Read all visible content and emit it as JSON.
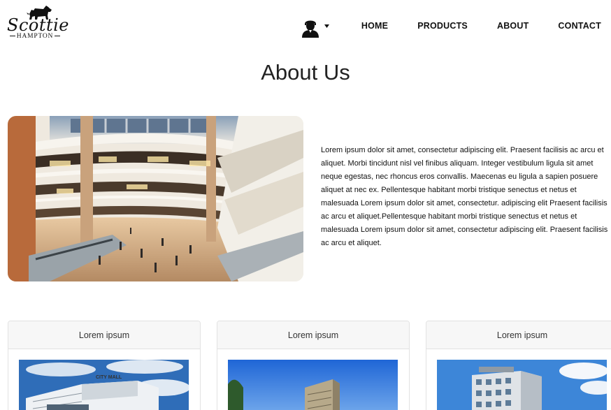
{
  "brand": {
    "logo_script": "Scottie",
    "logo_sub": "HAMPTON",
    "logo_icon": "scottie-dog-icon"
  },
  "nav": {
    "user_icon": "user-icon",
    "user_menu_caret": "caret-down-icon",
    "links": [
      {
        "label": "HOME"
      },
      {
        "label": "PRODUCTS"
      },
      {
        "label": "ABOUT"
      },
      {
        "label": "CONTACT"
      }
    ]
  },
  "page": {
    "title": "About Us",
    "image_subject": "shopping-mall-atrium-photo",
    "body": "Lorem ipsum dolor sit amet, consectetur adipiscing elit. Praesent facilisis ac arcu et aliquet. Morbi tincidunt nisl vel finibus aliquam. Integer vestibulum ligula sit amet neque egestas, nec rhoncus eros convallis. Maecenas eu ligula a sapien posuere aliquet at nec ex. Pellentesque habitant morbi tristique senectus et netus et malesuada Lorem ipsum dolor sit amet, consectetur. adipiscing elit Praesent facilisis ac arcu et aliquet.Pellentesque habitant morbi tristique senectus et netus et malesuada Lorem ipsum dolor sit amet, consectetur adipiscing elit. Praesent facilisis ac arcu et aliquet."
  },
  "cards": [
    {
      "header": "Lorem ipsum",
      "image_subject": "city-mall-building-photo",
      "sign": "CITY MALL"
    },
    {
      "header": "Lorem ipsum",
      "image_subject": "modern-building-photo"
    },
    {
      "header": "Lorem ipsum",
      "image_subject": "office-building-photo"
    }
  ],
  "colors": {
    "text": "#111111",
    "card_header_bg": "#f7f7f7",
    "card_border": "#e2e2e2",
    "sky": "#3c7fd1"
  }
}
